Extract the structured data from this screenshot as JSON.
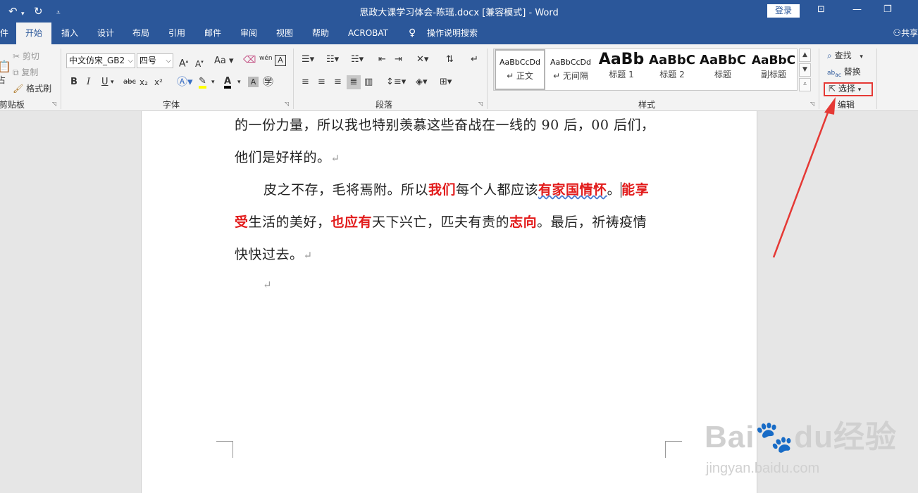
{
  "titlebar": {
    "title": "思政大课学习体会-陈瑶.docx [兼容模式] - Word",
    "login_label": "登录"
  },
  "tabs": [
    {
      "label": "件"
    },
    {
      "label": "开始"
    },
    {
      "label": "插入"
    },
    {
      "label": "设计"
    },
    {
      "label": "布局"
    },
    {
      "label": "引用"
    },
    {
      "label": "邮件"
    },
    {
      "label": "审阅"
    },
    {
      "label": "视图"
    },
    {
      "label": "帮助"
    },
    {
      "label": "ACROBAT"
    },
    {
      "label": "操作说明搜索"
    }
  ],
  "share_label": "共享",
  "ribbon": {
    "clipboard": {
      "group_label": "剪贴板",
      "cut_label": "剪切",
      "copy_label": "复制",
      "format_painter_label": "格式刷",
      "paste_label": "占"
    },
    "font": {
      "group_label": "字体",
      "font_name": "中文仿宋_GB2",
      "font_size": "四号",
      "grow_label": "A",
      "shrink_label": "A",
      "case_label": "Aa",
      "wen_label": "wén",
      "bold": "B",
      "italic": "I",
      "underline": "U",
      "strike": "abc",
      "subscript": "x₂",
      "superscript": "x²"
    },
    "paragraph": {
      "group_label": "段落"
    },
    "styles": {
      "group_label": "样式",
      "items": [
        {
          "sample": "AaBbCcDd",
          "name": "↵ 正文"
        },
        {
          "sample": "AaBbCcDd",
          "name": "↵ 无间隔"
        },
        {
          "sample": "AaBb",
          "name": "标题 1"
        },
        {
          "sample": "AaBbC",
          "name": "标题 2"
        },
        {
          "sample": "AaBbC",
          "name": "标题"
        },
        {
          "sample": "AaBbC",
          "name": "副标题"
        }
      ]
    },
    "editing": {
      "group_label": "编辑",
      "find_label": "查找",
      "replace_label": "替换",
      "select_label": "选择"
    }
  },
  "document": {
    "line1": "的一份力量，所以我也特别羡慕这些奋战在一线的 90 后，00 后们，",
    "line2": "他们是好样的。",
    "line3": {
      "a": "皮之不存，毛将焉附。所以",
      "b": "我们",
      "c": "每个人都应该",
      "d": "有家国情怀",
      "e": "。",
      "f": "能享"
    },
    "line4": {
      "a": "受",
      "b": "生活的美好，",
      "c": "也应有",
      "d": "天下兴亡，匹夫有责的",
      "e": "志向",
      "f": "。最后，祈祷疫情"
    },
    "line5": "快快过去。",
    "para_mark": "↵"
  },
  "watermark": {
    "main": "Bai🐾du经验",
    "sub": "jingyan.baidu.com"
  },
  "colors": {
    "title_bar": "#2b579a",
    "highlight": "#e53935",
    "text_red": "#e21b1b"
  }
}
